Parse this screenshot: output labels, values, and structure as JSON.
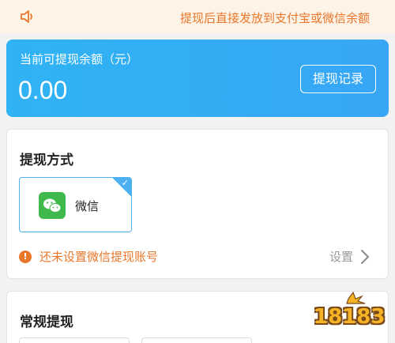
{
  "notice": {
    "icon": "speaker-icon",
    "text": "提现后直接发放到支付宝或微信余额"
  },
  "balance": {
    "label": "当前可提现余额（元）",
    "amount": "0.00",
    "record_button": "提现记录"
  },
  "withdraw_method": {
    "title": "提现方式",
    "options": [
      {
        "label": "微信",
        "icon": "wechat-icon",
        "selected": true
      }
    ],
    "warning_text": "还未设置微信提现账号",
    "setting_label": "设置"
  },
  "regular_withdraw": {
    "title": "常规提现"
  },
  "watermark": {
    "text": "18183"
  },
  "colors": {
    "accent_blue": "#38a6f5",
    "warning_orange": "#e8772c",
    "wechat_green": "#3fb94b",
    "notice_bg": "#fdf3e7"
  }
}
